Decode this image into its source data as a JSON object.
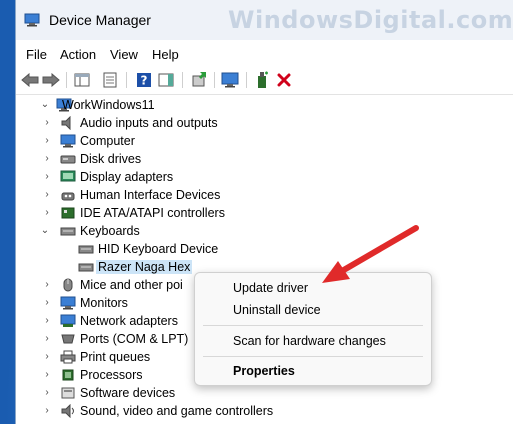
{
  "window": {
    "title": "Device Manager",
    "watermark": "WindowsDigital.com"
  },
  "menu": [
    "File",
    "Action",
    "View",
    "Help"
  ],
  "tree": {
    "root": "WorkWindows11",
    "items": [
      {
        "label": "Audio inputs and outputs",
        "icon": "speaker-icon",
        "expanded": false
      },
      {
        "label": "Computer",
        "icon": "monitor-icon",
        "expanded": false
      },
      {
        "label": "Disk drives",
        "icon": "disk-drive-icon",
        "expanded": false
      },
      {
        "label": "Display adapters",
        "icon": "display-adapter-icon",
        "expanded": false
      },
      {
        "label": "Human Interface Devices",
        "icon": "hid-icon",
        "expanded": false
      },
      {
        "label": "IDE ATA/ATAPI controllers",
        "icon": "ide-controller-icon",
        "expanded": false
      },
      {
        "label": "Keyboards",
        "icon": "keyboard-icon",
        "expanded": true
      },
      {
        "label": "HID Keyboard Device",
        "icon": "keyboard-icon",
        "child": true
      },
      {
        "label": "Razer Naga Hex",
        "icon": "keyboard-icon",
        "child": true,
        "selected": true
      },
      {
        "label": "Mice and other poi",
        "icon": "mouse-icon",
        "expanded": false
      },
      {
        "label": "Monitors",
        "icon": "monitor-icon",
        "expanded": false
      },
      {
        "label": "Network adapters",
        "icon": "network-icon",
        "expanded": false
      },
      {
        "label": "Ports (COM & LPT)",
        "icon": "port-icon",
        "expanded": false
      },
      {
        "label": "Print queues",
        "icon": "printer-icon",
        "expanded": false
      },
      {
        "label": "Processors",
        "icon": "processor-icon",
        "expanded": false
      },
      {
        "label": "Software devices",
        "icon": "software-device-icon",
        "expanded": false
      },
      {
        "label": "Sound, video and game controllers",
        "icon": "sound-icon",
        "expanded": false
      }
    ]
  },
  "context_menu": {
    "update": "Update driver",
    "uninstall": "Uninstall device",
    "scan": "Scan for hardware changes",
    "properties": "Properties"
  },
  "colors": {
    "selection": "#cce4f7",
    "arrow": "#e02a2a",
    "remove_x": "#d0021b"
  }
}
